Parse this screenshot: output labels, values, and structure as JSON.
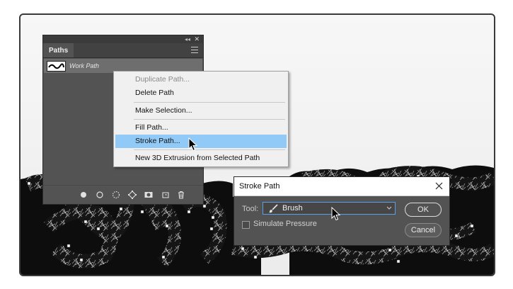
{
  "panel": {
    "tab": "Paths",
    "path_name": "Work Path",
    "footer_icons": [
      "fill-path-icon",
      "stroke-path-icon",
      "load-selection-icon",
      "make-work-path-icon",
      "add-mask-icon",
      "new-path-icon",
      "trash-icon"
    ]
  },
  "context_menu": {
    "items": [
      {
        "label": "Duplicate Path...",
        "state": "disabled"
      },
      {
        "label": "Delete Path",
        "state": "normal"
      },
      {
        "label": "Make Selection...",
        "state": "normal"
      },
      {
        "label": "Fill Path...",
        "state": "normal"
      },
      {
        "label": "Stroke Path...",
        "state": "highlighted"
      },
      {
        "label": "New 3D Extrusion from Selected Path",
        "state": "normal"
      }
    ]
  },
  "dialog": {
    "title": "Stroke Path",
    "tool_label": "Tool:",
    "tool_value": "Brush",
    "simulate_pressure_label": "Simulate Pressure",
    "simulate_pressure_checked": false,
    "ok_label": "OK",
    "cancel_label": "Cancel"
  },
  "colors": {
    "highlight": "#91c9f7",
    "panel_bg": "#535353",
    "select_border": "#5ba0e6"
  }
}
